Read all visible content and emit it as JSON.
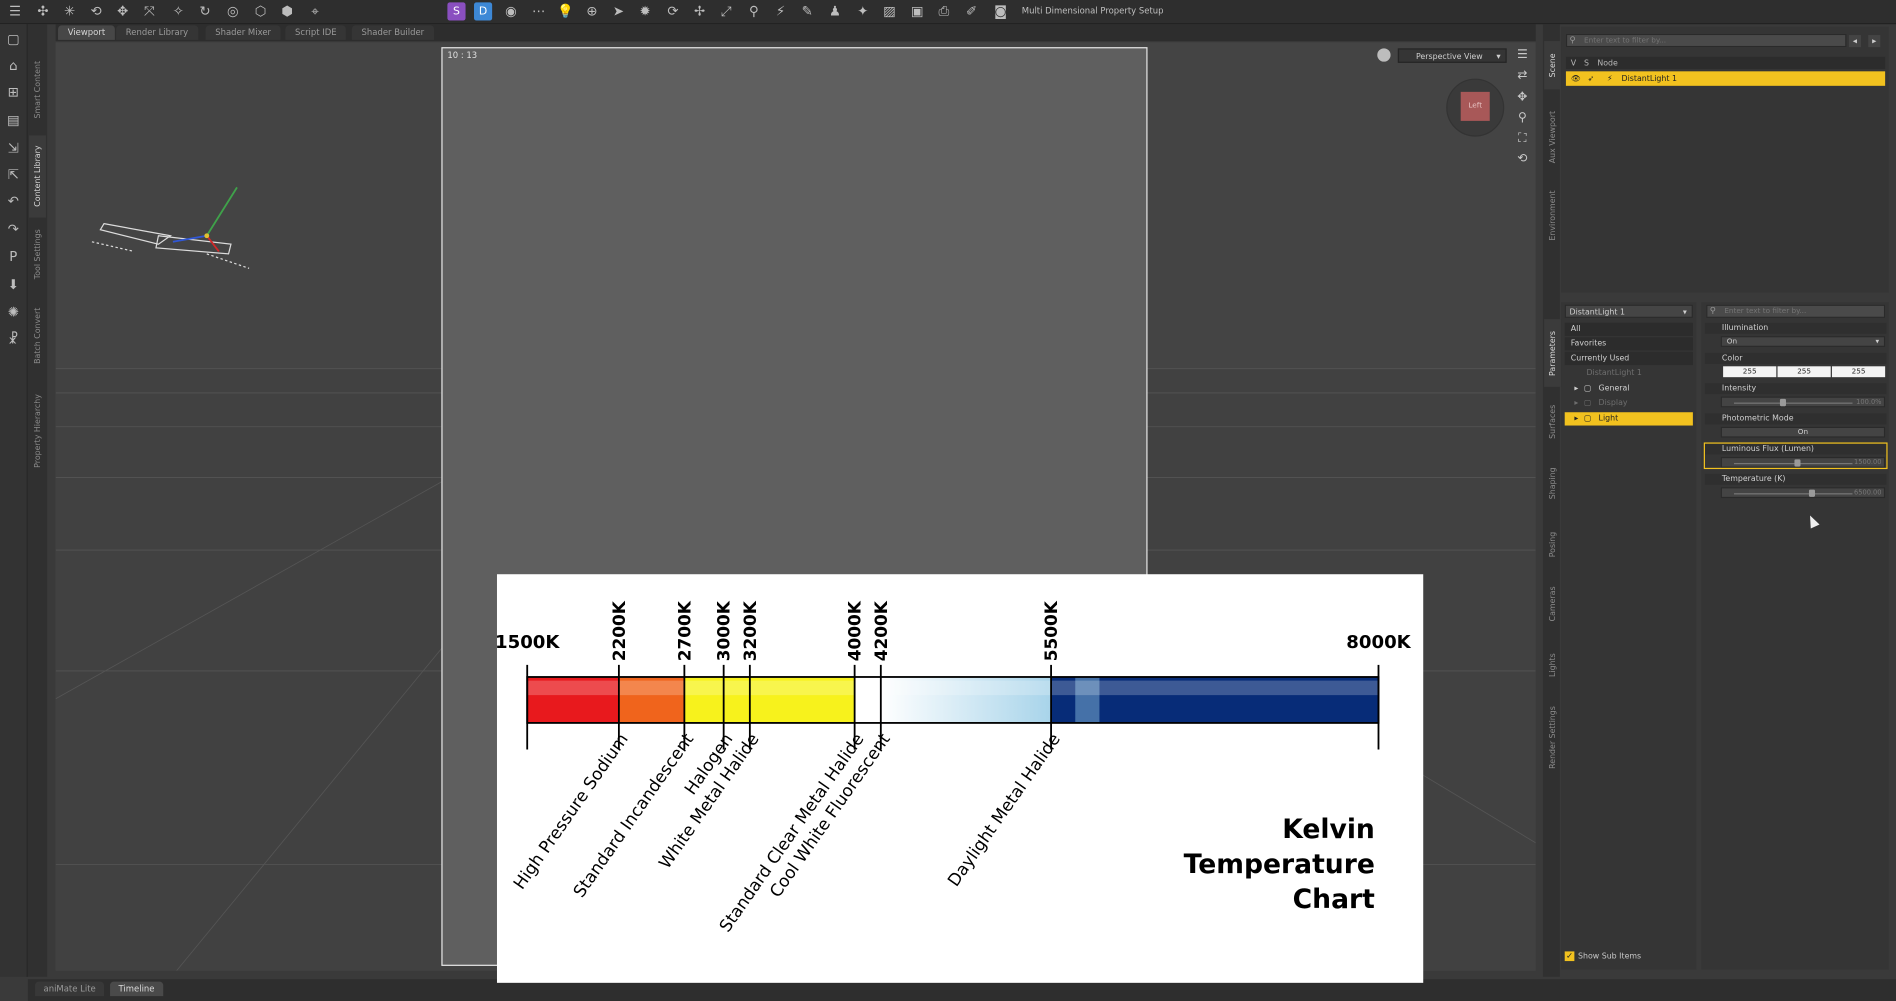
{
  "toolbar": {
    "right_label": "Multi Dimensional Property Setup"
  },
  "left_tabs": [
    "Smart Content",
    "Content Library",
    "Tool Settings",
    "Batch Convert",
    "Property Hierarchy"
  ],
  "viewport": {
    "tabs": [
      "Viewport",
      "Render Library",
      "Shader Mixer",
      "Script IDE",
      "Shader Builder"
    ],
    "active_tab": "Viewport",
    "frame_clock": "10 : 13",
    "view_mode": "Perspective View",
    "cube_label": "Left"
  },
  "bottom_tabs": [
    "aniMate Lite",
    "Timeline"
  ],
  "right_tabs": [
    "Scene",
    "Aux Viewport",
    "Environment",
    "Parameters",
    "Surfaces",
    "Shaping",
    "Posing",
    "Cameras",
    "Lights",
    "Render Settings"
  ],
  "scene": {
    "filter_placeholder": "Enter text to filter by...",
    "col_v": "V",
    "col_s": "S",
    "col_node": "Node",
    "selected_node": "DistantLight 1"
  },
  "parameters": {
    "node_select": "DistantLight 1",
    "filter_placeholder": "Enter text to filter by...",
    "list": [
      "All",
      "Favorites",
      "Currently Used"
    ],
    "tree_root": "DistantLight 1",
    "tree": [
      "General",
      "Display",
      "Light"
    ],
    "selected_group": "Light",
    "props": {
      "illumination_label": "Illumination",
      "illumination_value": "On",
      "color_label": "Color",
      "color_r": "255",
      "color_g": "255",
      "color_b": "255",
      "intensity_label": "Intensity",
      "intensity_value": "100.0%",
      "intensity_level": 0.38,
      "photometric_label": "Photometric Mode",
      "photometric_value": "On",
      "flux_label": "Luminous Flux (Lumen)",
      "flux_value": "1500.00",
      "flux_level": 0.5,
      "temp_label": "Temperature (K)",
      "temp_value": "6500.00",
      "temp_level": 0.62
    },
    "show_sub_items": "Show Sub Items"
  },
  "chart_data": {
    "type": "bar",
    "title_lines": [
      "Kelvin",
      "Temperature",
      "Chart"
    ],
    "x": [
      1500,
      2200,
      2700,
      3000,
      3200,
      4000,
      4200,
      5500,
      8000
    ],
    "tick_labels": [
      "1500K",
      "2200K",
      "2700K",
      "3000K",
      "3200K",
      "4000K",
      "4200K",
      "5500K",
      "8000K"
    ],
    "xlim": [
      1500,
      8000
    ],
    "annotations": [
      {
        "x": 2200,
        "label": "High Pressure Sodium"
      },
      {
        "x": 2700,
        "label": "Standard Incandescent"
      },
      {
        "x": 3000,
        "label": "Halogen"
      },
      {
        "x": 3200,
        "label": "White Metal Halide"
      },
      {
        "x": 4000,
        "label": "Standard Clear Metal Halide"
      },
      {
        "x": 4200,
        "label": "Cool White Fluorescent"
      },
      {
        "x": 5500,
        "label": "Daylight Metal Halide"
      }
    ],
    "color_bands": [
      {
        "from": 1500,
        "to": 2200,
        "color": "#e8191d"
      },
      {
        "from": 2200,
        "to": 2700,
        "color": "#f0641c"
      },
      {
        "from": 2700,
        "to": 4000,
        "color": "#f7f21c"
      },
      {
        "from": 4000,
        "to": 4200,
        "color": "#ffffff"
      },
      {
        "from": 4200,
        "to": 5500,
        "color": "#a8d4ea"
      },
      {
        "from": 5500,
        "to": 8000,
        "color": "#072c78"
      }
    ]
  }
}
